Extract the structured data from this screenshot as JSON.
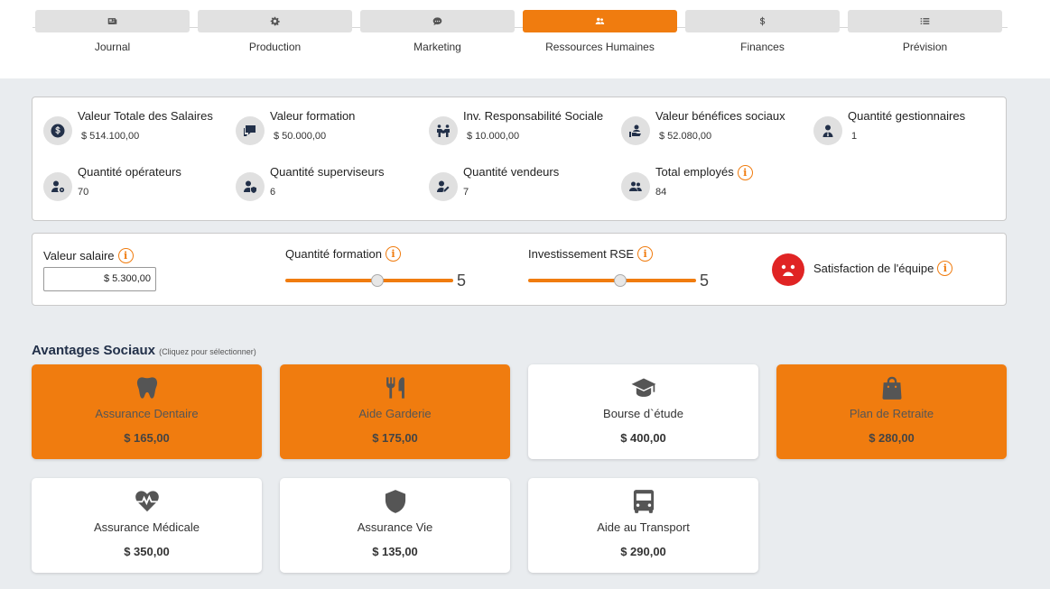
{
  "nav": {
    "tabs": [
      {
        "label": "Journal",
        "icon": "newspaper-icon",
        "active": false
      },
      {
        "label": "Production",
        "icon": "gear-icon",
        "active": false
      },
      {
        "label": "Marketing",
        "icon": "chat-bubble-icon",
        "active": false
      },
      {
        "label": "Ressources Humaines",
        "icon": "users-icon",
        "active": true
      },
      {
        "label": "Finances",
        "icon": "dollar-icon",
        "active": false
      },
      {
        "label": "Prévision",
        "icon": "list-icon",
        "active": false
      }
    ]
  },
  "kpis": [
    {
      "label": "Valeur Totale des Salaires",
      "value": "$ 514.100,00",
      "icon": "dollar-circle-icon"
    },
    {
      "label": "Valeur formation",
      "value": "$ 50.000,00",
      "icon": "chalkboard-icon"
    },
    {
      "label": "Inv. Responsabilité Sociale",
      "value": "$ 10.000,00",
      "icon": "handshake-people-icon"
    },
    {
      "label": "Valeur bénéfices sociaux",
      "value": "$ 52.080,00",
      "icon": "hand-user-icon"
    },
    {
      "label": "Quantité gestionnaires",
      "value": "1",
      "icon": "user-tie-icon"
    },
    {
      "label": "Quantité opérateurs",
      "value": "70",
      "icon": "user-gear-icon"
    },
    {
      "label": "Quantité superviseurs",
      "value": "6",
      "icon": "user-shield-icon"
    },
    {
      "label": "Quantité vendeurs",
      "value": "7",
      "icon": "user-edit-icon"
    },
    {
      "label": "Total employés",
      "value": "84",
      "icon": "users-icon"
    }
  ],
  "controls": {
    "salary_label": "Valeur salaire",
    "salary_value": "$ 5.300,00",
    "training_label": "Quantité formation",
    "training_value": "5",
    "training_fraction": 0.55,
    "rse_label": "Investissement RSE",
    "rse_value": "5",
    "rse_fraction": 0.55,
    "satisfaction_label": "Satisfaction de l'équipe",
    "info_glyph": "i",
    "face_color": "#e02424"
  },
  "benefits": {
    "title": "Avantages Sociaux",
    "hint": "(Cliquez pour sélectionner)",
    "items": [
      {
        "name": "Assurance Dentaire",
        "price": "$ 165,00",
        "icon": "tooth-icon",
        "selected": true
      },
      {
        "name": "Aide Garderie",
        "price": "$ 175,00",
        "icon": "utensils-icon",
        "selected": true
      },
      {
        "name": "Bourse d`étude",
        "price": "$ 400,00",
        "icon": "graduation-cap-icon",
        "selected": false
      },
      {
        "name": "Plan de Retraite",
        "price": "$ 280,00",
        "icon": "shopping-bag-icon",
        "selected": true
      },
      {
        "name": "Assurance Médicale",
        "price": "$ 350,00",
        "icon": "heartbeat-icon",
        "selected": false
      },
      {
        "name": "Assurance Vie",
        "price": "$ 135,00",
        "icon": "shield-icon",
        "selected": false
      },
      {
        "name": "Aide au Transport",
        "price": "$ 290,00",
        "icon": "bus-icon",
        "selected": false
      }
    ]
  },
  "colors": {
    "accent": "#f07c0f",
    "icon_dark": "#223049",
    "danger": "#e02424"
  }
}
